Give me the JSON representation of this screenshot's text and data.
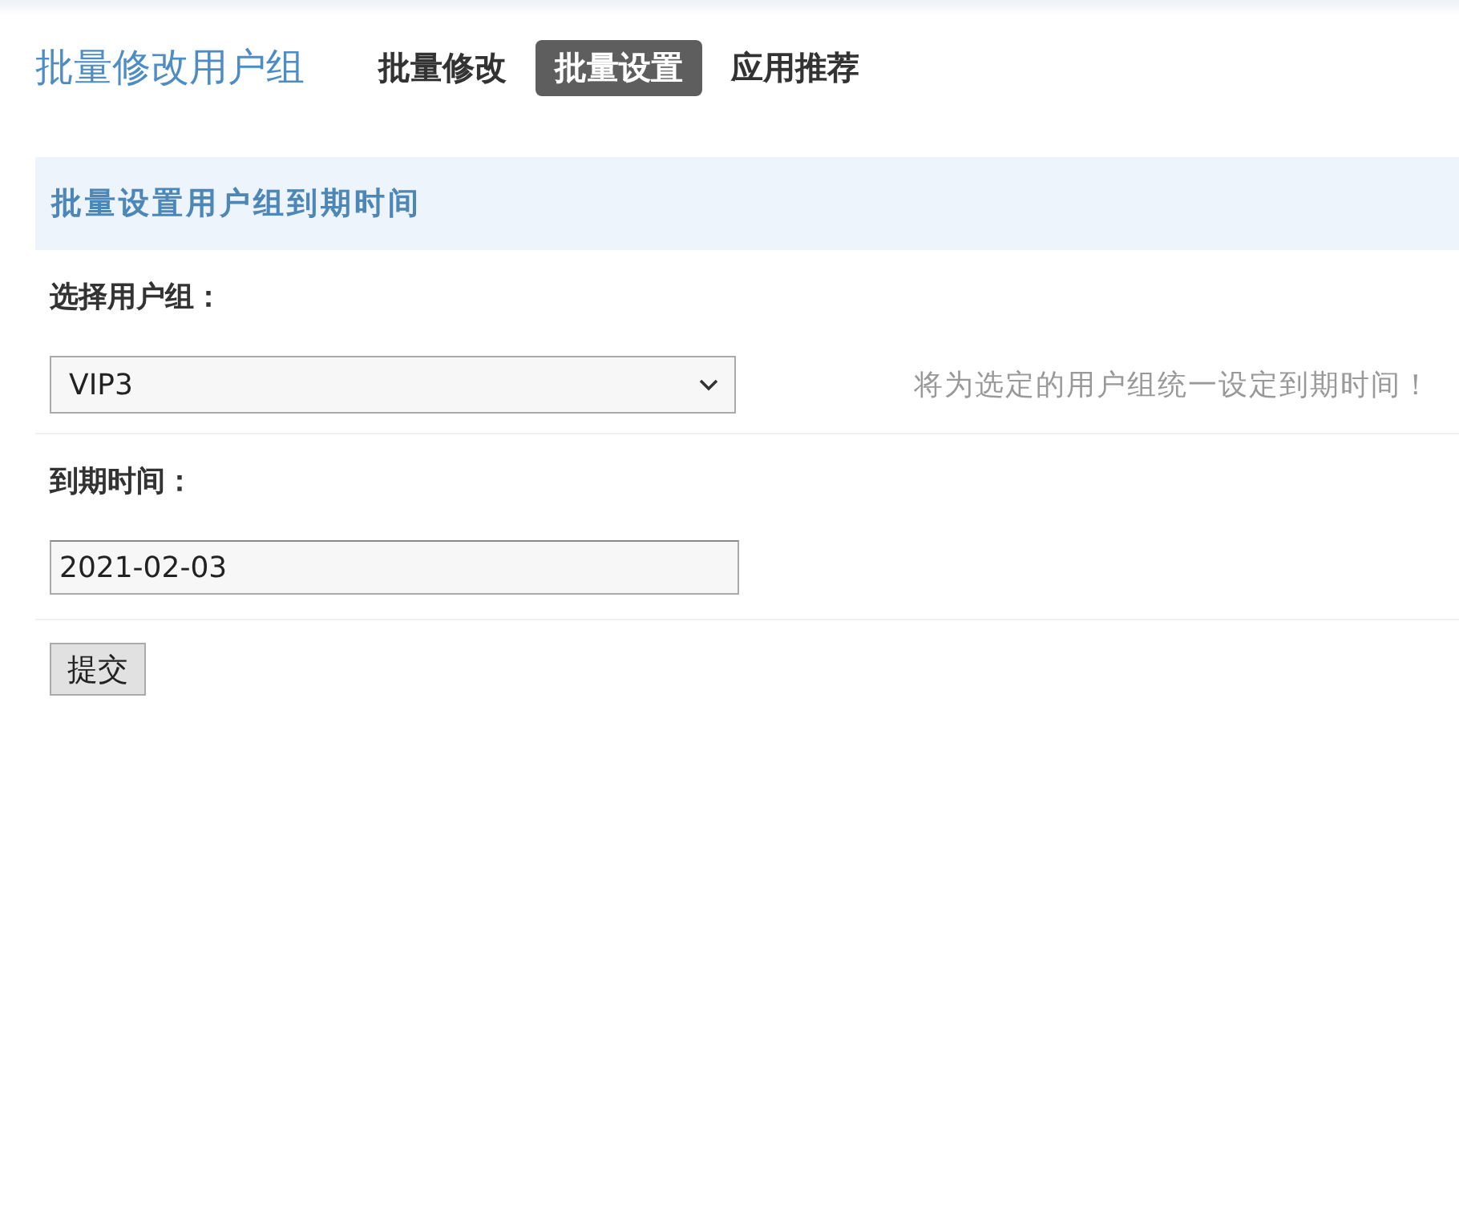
{
  "header": {
    "title": "批量修改用户组",
    "tabs": [
      {
        "label": "批量修改",
        "selected": false
      },
      {
        "label": "批量设置",
        "selected": true
      },
      {
        "label": "应用推荐",
        "selected": false
      }
    ]
  },
  "section": {
    "title": "批量设置用户组到期时间"
  },
  "form": {
    "rows": [
      {
        "kind": "select",
        "label": "选择用户组：",
        "value": "VIP3",
        "hint": "将为选定的用户组统一设定到期时间！"
      },
      {
        "kind": "text",
        "label": "到期时间：",
        "value": "2021-02-03"
      }
    ],
    "submit": "提交"
  }
}
